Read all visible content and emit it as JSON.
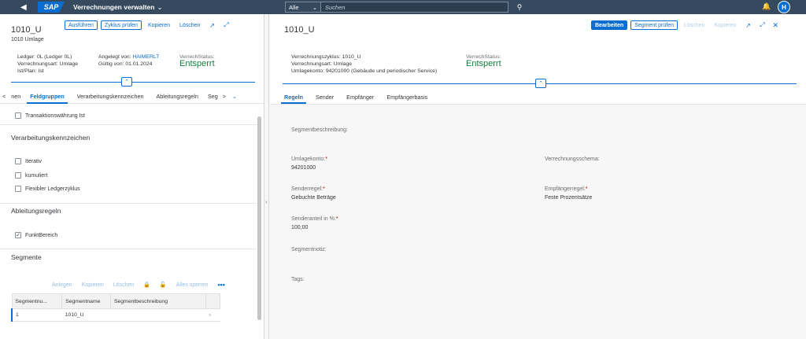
{
  "shell": {
    "back_icon": "◀",
    "logo": "SAP",
    "app_title": "Verrechnungen verwalten",
    "search_scope": "Alle",
    "search_placeholder": "Suchen",
    "avatar_initial": "H"
  },
  "left": {
    "title": "1010_U",
    "subtitle": "1010 Umlage",
    "toolbar": {
      "ausfuehren": "Ausführen",
      "zyklus_pruefen": "Zyklus prüfen",
      "kopieren": "Kopieren",
      "loeschen": "Löschen"
    },
    "header": {
      "ledger": "Ledger: 0L (Ledger 0L)",
      "verrechnungsart": "Verrechnungsart: Umlage",
      "istplan": "Ist/Plan: Ist",
      "angelegt_label": "Angelegt von:",
      "angelegt_value": "HAIMERLT",
      "gueltig": "Gültig von: 01.01.2024",
      "status_label": "VerrechStatus:",
      "status_value": "Entsperrt"
    },
    "tabs": [
      "nen",
      "Feldgruppen",
      "Verarbeitungskennzeichen",
      "Ableitungsregeln",
      "Seg"
    ],
    "transaktionswaehrung": "Transaktionswährung Ist",
    "sec_verarbeitung": "Verarbeitungskennzeichen",
    "cb_iterativ": "Iterativ",
    "cb_kumuliert": "kumuliert",
    "cb_flexibel": "Flexibler Ledgerzyklus",
    "sec_ableitung": "Ableitungsregeln",
    "cb_funkt": "FunktBereich",
    "sec_segmente": "Segmente",
    "seg_toolbar": {
      "anlegen": "Anlegen",
      "kopieren": "Kopieren",
      "loeschen": "Löschen",
      "alle_sperren": "Alles sperren",
      "more": "•••"
    },
    "table": {
      "headers": [
        "Segmentnu...",
        "Segmentname",
        "Segmentbeschreibung"
      ],
      "rows": [
        {
          "nr": "1",
          "name": "1010_U",
          "desc": ""
        }
      ]
    }
  },
  "right": {
    "title": "1010_U",
    "toolbar": {
      "bearbeiten": "Bearbeiten",
      "segment_pruefen": "Segment prüfen",
      "loeschen": "Löschen",
      "kopieren": "Kopieren"
    },
    "header": {
      "zyklus": "Verrechnungszyklus: 1010_U",
      "art": "Verrechnungsart: Umlage",
      "konto": "Umlagekonto: 94201000 (Gebäude und periodischer Service)",
      "status_label": "VerrechStatus:",
      "status_value": "Entsperrt"
    },
    "tabs": [
      "Regeln",
      "Sender",
      "Empfänger",
      "Empfängerbasis"
    ],
    "form": {
      "segmentbeschreibung": "Segmentbeschreibung:",
      "umlagekonto_label": "Umlagekonto:",
      "umlagekonto_value": "94201000",
      "schema_label": "Verrechnungsschema:",
      "senderregel_label": "Senderregel:",
      "senderregel_value": "Gebuchte Beträge",
      "empfaengerregel_label": "Empfängerregel:",
      "empfaengerregel_value": "Feste Prozentsätze",
      "senderanteil_label": "Senderanteil in %:",
      "senderanteil_value": "100,00",
      "segmentnotiz": "Segmentnotiz:",
      "tags": "Tags:",
      "required_mark": "*"
    }
  }
}
